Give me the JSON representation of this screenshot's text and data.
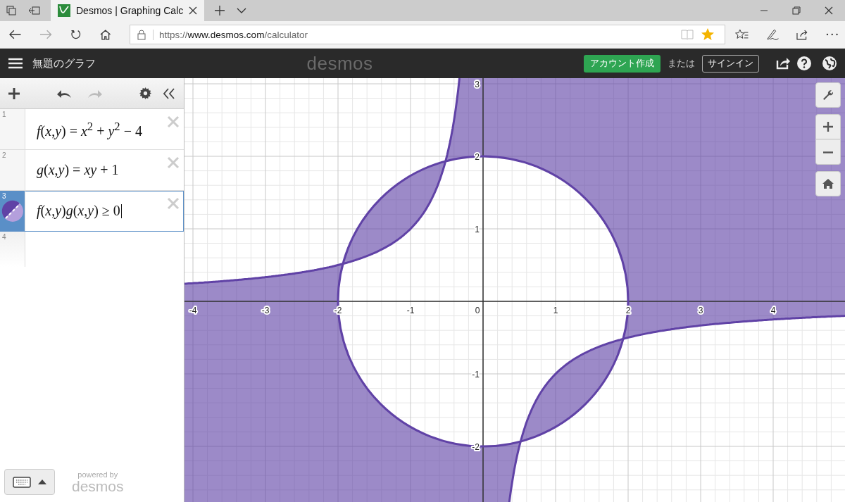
{
  "browser": {
    "tabs": [
      {
        "title": "Desmos | Graphing Calc",
        "selected": true
      }
    ],
    "url_scheme": "https://",
    "url_host": "www.desmos.com",
    "url_path": "/calculator",
    "favorite": true
  },
  "header": {
    "title": "無題のグラフ",
    "logo": "desmos",
    "create_account": "アカウント作成",
    "or": "または",
    "sign_in": "サインイン"
  },
  "expressions": [
    {
      "number": "1",
      "text": "*f*(*x*,*y*) = *x*$^{2}$ + *y*$^{2}$ − 4",
      "kind": "definition",
      "selected": false
    },
    {
      "number": "2",
      "text": "*g*(*x*,*y*) = *xy* + 1",
      "kind": "definition",
      "selected": false
    },
    {
      "number": "3",
      "text": "*f*(*x*,*y*)*g*(*x*,*y*) ≥ 0",
      "kind": "inequality",
      "selected": true
    }
  ],
  "empty_row_number": "4",
  "graph": {
    "x_ticks": [
      "-4",
      "-3",
      "-2",
      "-1",
      "0",
      "1",
      "2",
      "3",
      "4"
    ],
    "y_ticks": [
      "3",
      "2",
      "1",
      "-1",
      "-2"
    ]
  },
  "footer": {
    "powered_by": "powered by",
    "logo": "desmos"
  }
}
